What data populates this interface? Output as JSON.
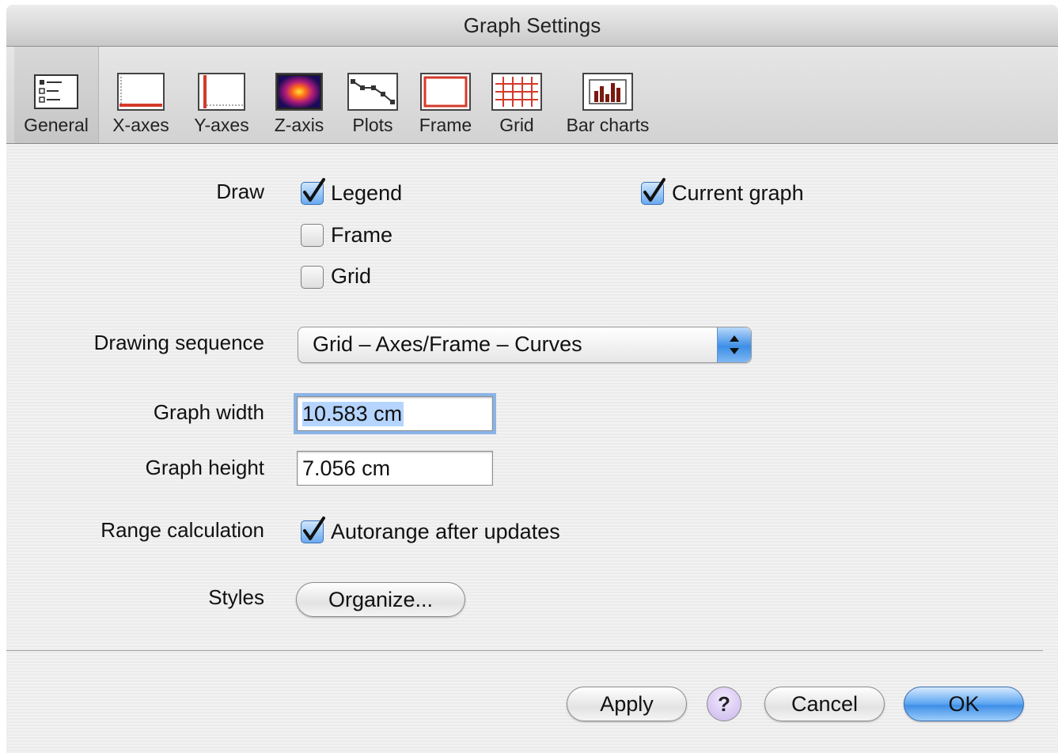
{
  "window": {
    "title": "Graph Settings"
  },
  "toolbar": {
    "items": [
      {
        "label": "General",
        "icon": "general-icon"
      },
      {
        "label": "X-axes",
        "icon": "x-axes-icon"
      },
      {
        "label": "Y-axes",
        "icon": "y-axes-icon"
      },
      {
        "label": "Z-axis",
        "icon": "z-axis-icon"
      },
      {
        "label": "Plots",
        "icon": "plots-icon"
      },
      {
        "label": "Frame",
        "icon": "frame-icon"
      },
      {
        "label": "Grid",
        "icon": "grid-icon"
      },
      {
        "label": "Bar charts",
        "icon": "bar-charts-icon"
      }
    ],
    "selected": "General"
  },
  "form": {
    "draw_label": "Draw",
    "legend": {
      "label": "Legend",
      "checked": true
    },
    "frame": {
      "label": "Frame",
      "checked": false
    },
    "grid": {
      "label": "Grid",
      "checked": false
    },
    "current_graph": {
      "label": "Current graph",
      "checked": true
    },
    "drawing_sequence_label": "Drawing sequence",
    "drawing_sequence_value": "Grid – Axes/Frame – Curves",
    "graph_width_label": "Graph width",
    "graph_width_value": "10.583 cm",
    "graph_height_label": "Graph height",
    "graph_height_value": "7.056 cm",
    "range_label": "Range calculation",
    "autorange": {
      "label": "Autorange after updates",
      "checked": true
    },
    "styles_label": "Styles",
    "organize_label": "Organize..."
  },
  "buttons": {
    "apply": "Apply",
    "help": "?",
    "cancel": "Cancel",
    "ok": "OK"
  },
  "colors": {
    "accent_blue": "#3e8fe8",
    "axis_red": "#d43a2a"
  }
}
